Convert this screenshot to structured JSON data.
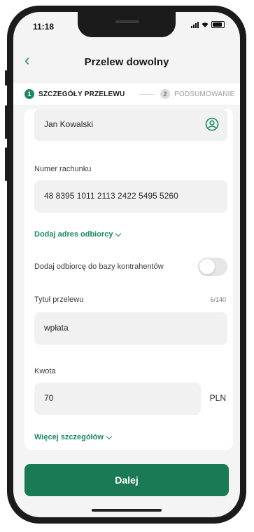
{
  "status": {
    "time": "11:18"
  },
  "header": {
    "title": "Przelew dowolny",
    "back_icon": "chevron-left-icon"
  },
  "stepper": {
    "step1": {
      "number": "1",
      "label": "SZCZEGÓŁY PRZELEWU",
      "active": true
    },
    "step2": {
      "number": "2",
      "label": "PODSUMOWANIE",
      "active": false
    }
  },
  "form": {
    "recipient_name": {
      "value": "Jan Kowalski",
      "icon": "person-circle-icon"
    },
    "account": {
      "label": "Numer rachunku",
      "value": "48 8395 1011 2113 2422 5495 5260"
    },
    "add_address_link": "Dodaj adres odbiorcy",
    "add_to_contacts": {
      "label": "Dodaj odbiorcę do bazy kontrahentów",
      "enabled": false
    },
    "title": {
      "label": "Tytuł przelewu",
      "counter": "6/140",
      "value": "wpłata"
    },
    "amount": {
      "label": "Kwota",
      "value": "70",
      "currency": "PLN"
    },
    "more_details_link": "Więcej szczegółów"
  },
  "actions": {
    "next_label": "Dalej"
  },
  "colors": {
    "accent": "#1a8a5e",
    "button": "#1a7a55"
  }
}
